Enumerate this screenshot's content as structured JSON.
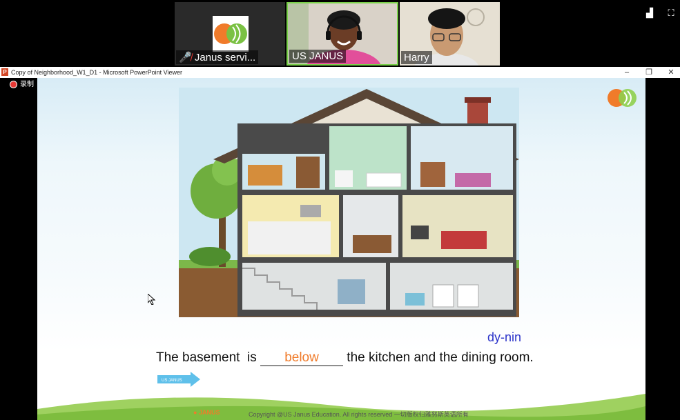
{
  "video_strip": {
    "participants": [
      {
        "name": "Janus servi...",
        "muted": true
      },
      {
        "name": "US JANUS"
      },
      {
        "name": "Harry"
      }
    ]
  },
  "window": {
    "title": "Copy of Neighborhood_W1_D1 - Microsoft PowerPoint Viewer",
    "app_icon": "P"
  },
  "recording": {
    "label": "录制"
  },
  "slide": {
    "hint": "dy-nin",
    "sentence_start": "The basement  is ",
    "answer": "below",
    "sentence_end": " the kitchen and the dining room.",
    "arrow_label": "US JANUS",
    "footer_logo": "JANUS",
    "copyright": "Copyright @US Janus Education. All rights reserved 一切版权归雅努斯英语所有"
  },
  "colors": {
    "accent_orange": "#f07b2a",
    "accent_green": "#7ad14a",
    "hint_blue": "#2b33c9"
  }
}
